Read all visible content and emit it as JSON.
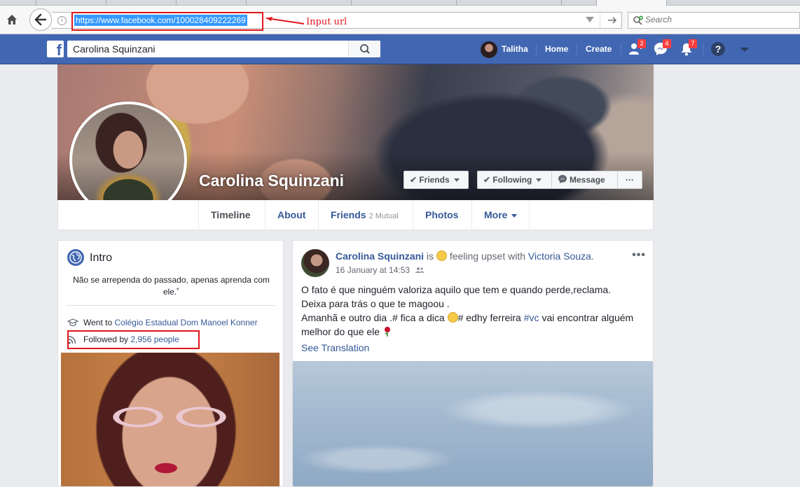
{
  "browser": {
    "url": "https://www.facebook.com/100028409222269",
    "search_placeholder": "Search"
  },
  "annotations": {
    "url_label": "Input url"
  },
  "fb_nav": {
    "search_value": "Carolina Squinzani",
    "user_name": "Talitha",
    "home": "Home",
    "create": "Create",
    "friend_requests_count": "2",
    "messages_count": "4",
    "notifications_count": "7"
  },
  "profile": {
    "name": "Carolina Squinzani",
    "buttons": {
      "friends": "Friends",
      "following": "Following",
      "message": "Message",
      "more": "···"
    },
    "tabs": {
      "timeline": "Timeline",
      "about": "About",
      "friends": "Friends",
      "friends_mutual": "2 Mutual",
      "photos": "Photos",
      "more": "More"
    }
  },
  "intro": {
    "title": "Intro",
    "bio": "Não se arrependa do passado, apenas aprenda com ele.˚",
    "went_to_prefix": "Went to",
    "went_to_school": "Colégio Estadual Dom Manoel Konner",
    "followed_prefix": "Followed by",
    "followed_count": "2,956 people"
  },
  "post": {
    "author": "Carolina Squinzani",
    "is": "is",
    "feeling": "feeling upset with",
    "tagged": "Victoria Souza",
    "dot": ".",
    "time": "16 January at 14:53",
    "line1": "O fato é que ninguém valoriza aquilo que tem e quando perde,reclama.",
    "line2": "Deixa para trás o que te magoou .",
    "line3a": "Amanhã e outro dia .# fica a dica",
    "line3b": "# edhy ferreira",
    "hashtag": "#vc",
    "line3c": "vai encontrar alguém melhor do que ele",
    "see_translation": "See Translation"
  },
  "colors": {
    "fb_blue": "#4267b2",
    "link": "#365899",
    "annotation_red": "#e0161c",
    "badge_red": "#fa3e3e"
  }
}
